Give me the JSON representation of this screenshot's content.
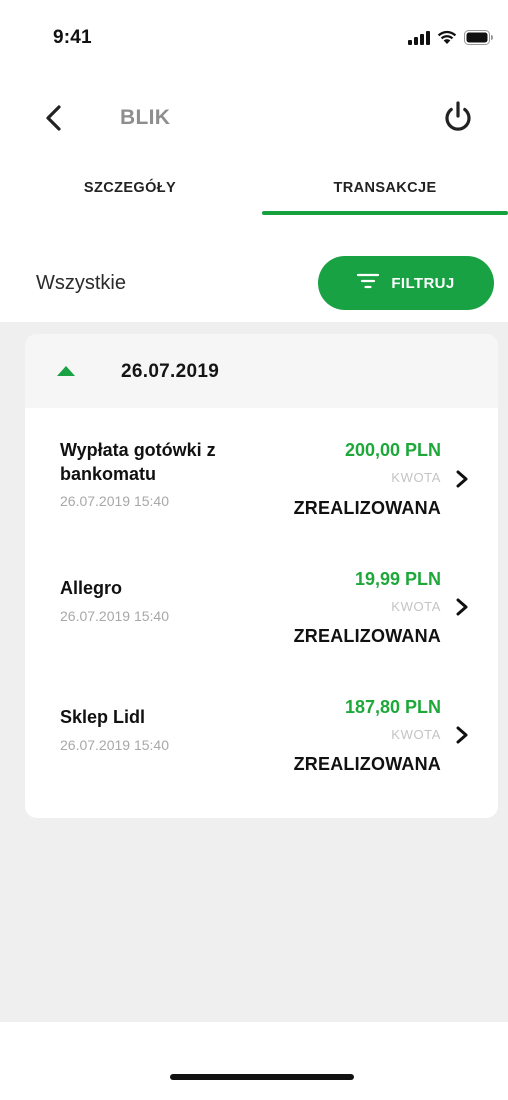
{
  "status_bar": {
    "time": "9:41",
    "icons": [
      "signal-icon",
      "wifi-icon",
      "battery-icon"
    ]
  },
  "header": {
    "title": "BLIK",
    "back_icon": "chevron-left-icon",
    "power_icon": "power-icon"
  },
  "tabs": [
    {
      "label": "SZCZEGÓŁY",
      "active": false
    },
    {
      "label": "TRANSAKCJE",
      "active": true
    }
  ],
  "filter": {
    "label": "Wszystkie",
    "button_label": "FILTRUJ",
    "button_icon": "filter-icon"
  },
  "group": {
    "date": "26.07.2019",
    "expanded": true,
    "caret_icon": "caret-up-icon"
  },
  "transactions": [
    {
      "name": "Wypłata gotówki z bankomatu",
      "datetime": "26.07.2019 15:40",
      "amount": "200,00 PLN",
      "amount_label": "KWOTA",
      "status": "ZREALIZOWANA"
    },
    {
      "name": "Allegro",
      "datetime": "26.07.2019 15:40",
      "amount": "19,99 PLN",
      "amount_label": "KWOTA",
      "status": "ZREALIZOWANA"
    },
    {
      "name": "Sklep Lidl",
      "datetime": "26.07.2019 15:40",
      "amount": "187,80 PLN",
      "amount_label": "KWOTA",
      "status": "ZREALIZOWANA"
    }
  ],
  "colors": {
    "accent": "#18a243",
    "amount": "#1fa83a",
    "background_gray": "#efefef",
    "muted_text": "#a8a8a8"
  }
}
